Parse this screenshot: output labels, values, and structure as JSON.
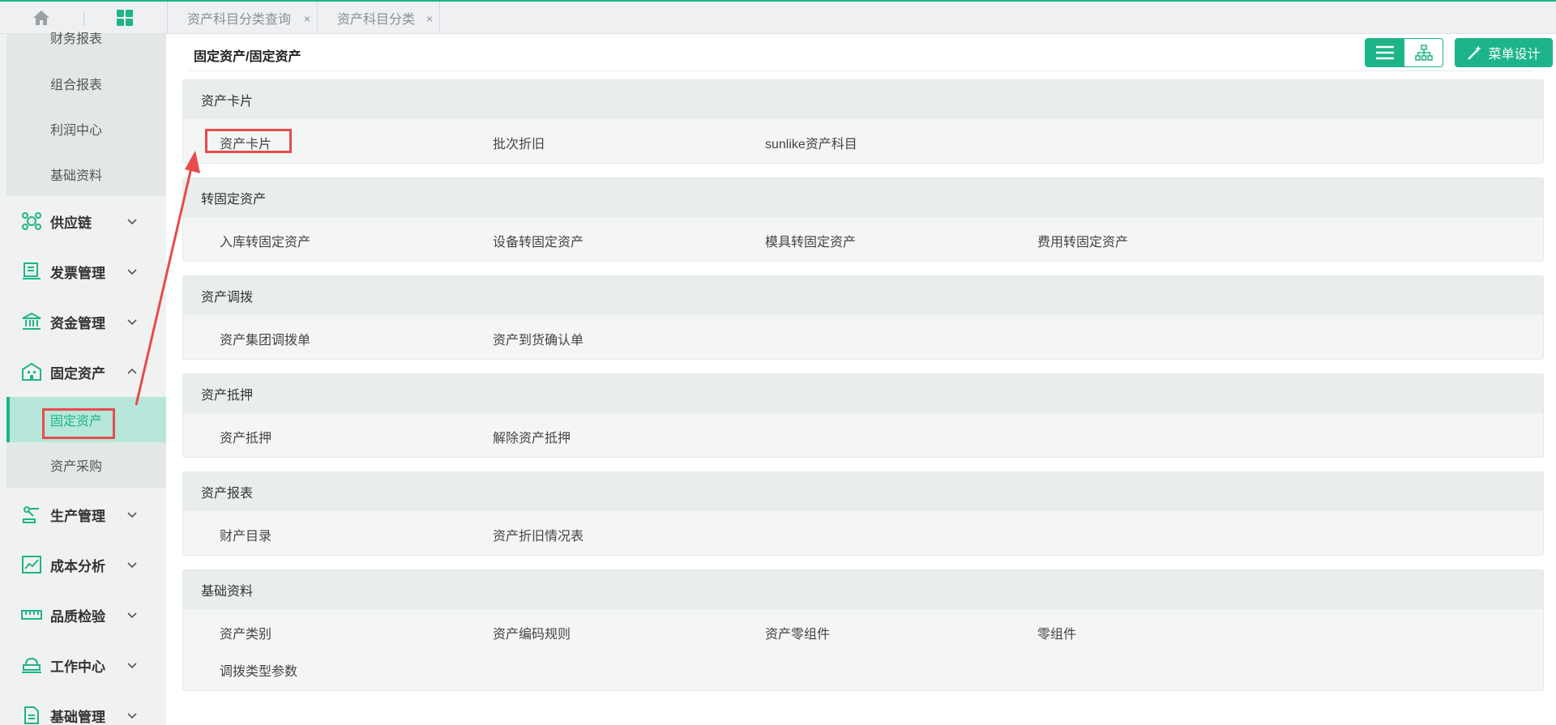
{
  "tabs": [
    {
      "label": "资产科目分类查询",
      "close": "×"
    },
    {
      "label": "资产科目分类",
      "close": "×"
    }
  ],
  "sidebar": {
    "report_items": [
      "财务报表",
      "组合报表",
      "利润中心",
      "基础资料"
    ],
    "menus": [
      {
        "label": "供应链",
        "icon": "supply-chain-icon",
        "expanded": false
      },
      {
        "label": "发票管理",
        "icon": "invoice-icon",
        "expanded": false
      },
      {
        "label": "资金管理",
        "icon": "bank-icon",
        "expanded": false
      },
      {
        "label": "固定资产",
        "icon": "building-icon",
        "expanded": true
      },
      {
        "label": "生产管理",
        "icon": "robot-arm-icon",
        "expanded": false
      },
      {
        "label": "成本分析",
        "icon": "trend-chart-icon",
        "expanded": false
      },
      {
        "label": "品质检验",
        "icon": "ruler-icon",
        "expanded": false
      },
      {
        "label": "工作中心",
        "icon": "workstation-icon",
        "expanded": false
      },
      {
        "label": "基础管理",
        "icon": "document-icon",
        "expanded": false
      }
    ],
    "asset_sub": [
      "固定资产",
      "资产采购"
    ]
  },
  "header": {
    "breadcrumb": "固定资产/固定资产",
    "design_button": "菜单设计"
  },
  "groups": [
    {
      "title": "资产卡片",
      "items": [
        "资产卡片",
        "批次折旧",
        "sunlike资产科目"
      ]
    },
    {
      "title": "转固定资产",
      "items": [
        "入库转固定资产",
        "设备转固定资产",
        "模具转固定资产",
        "费用转固定资产"
      ]
    },
    {
      "title": "资产调拨",
      "items": [
        "资产集团调拨单",
        "资产到货确认单"
      ]
    },
    {
      "title": "资产抵押",
      "items": [
        "资产抵押",
        "解除资产抵押"
      ]
    },
    {
      "title": "资产报表",
      "items": [
        "财产目录",
        "资产折旧情况表"
      ]
    },
    {
      "title": "基础资料",
      "items": [
        "资产类别",
        "资产编码规则",
        "资产零组件",
        "零组件",
        "调拨类型参数"
      ]
    }
  ],
  "colors": {
    "accent": "#1db48a",
    "highlight": "#e84b4b"
  }
}
